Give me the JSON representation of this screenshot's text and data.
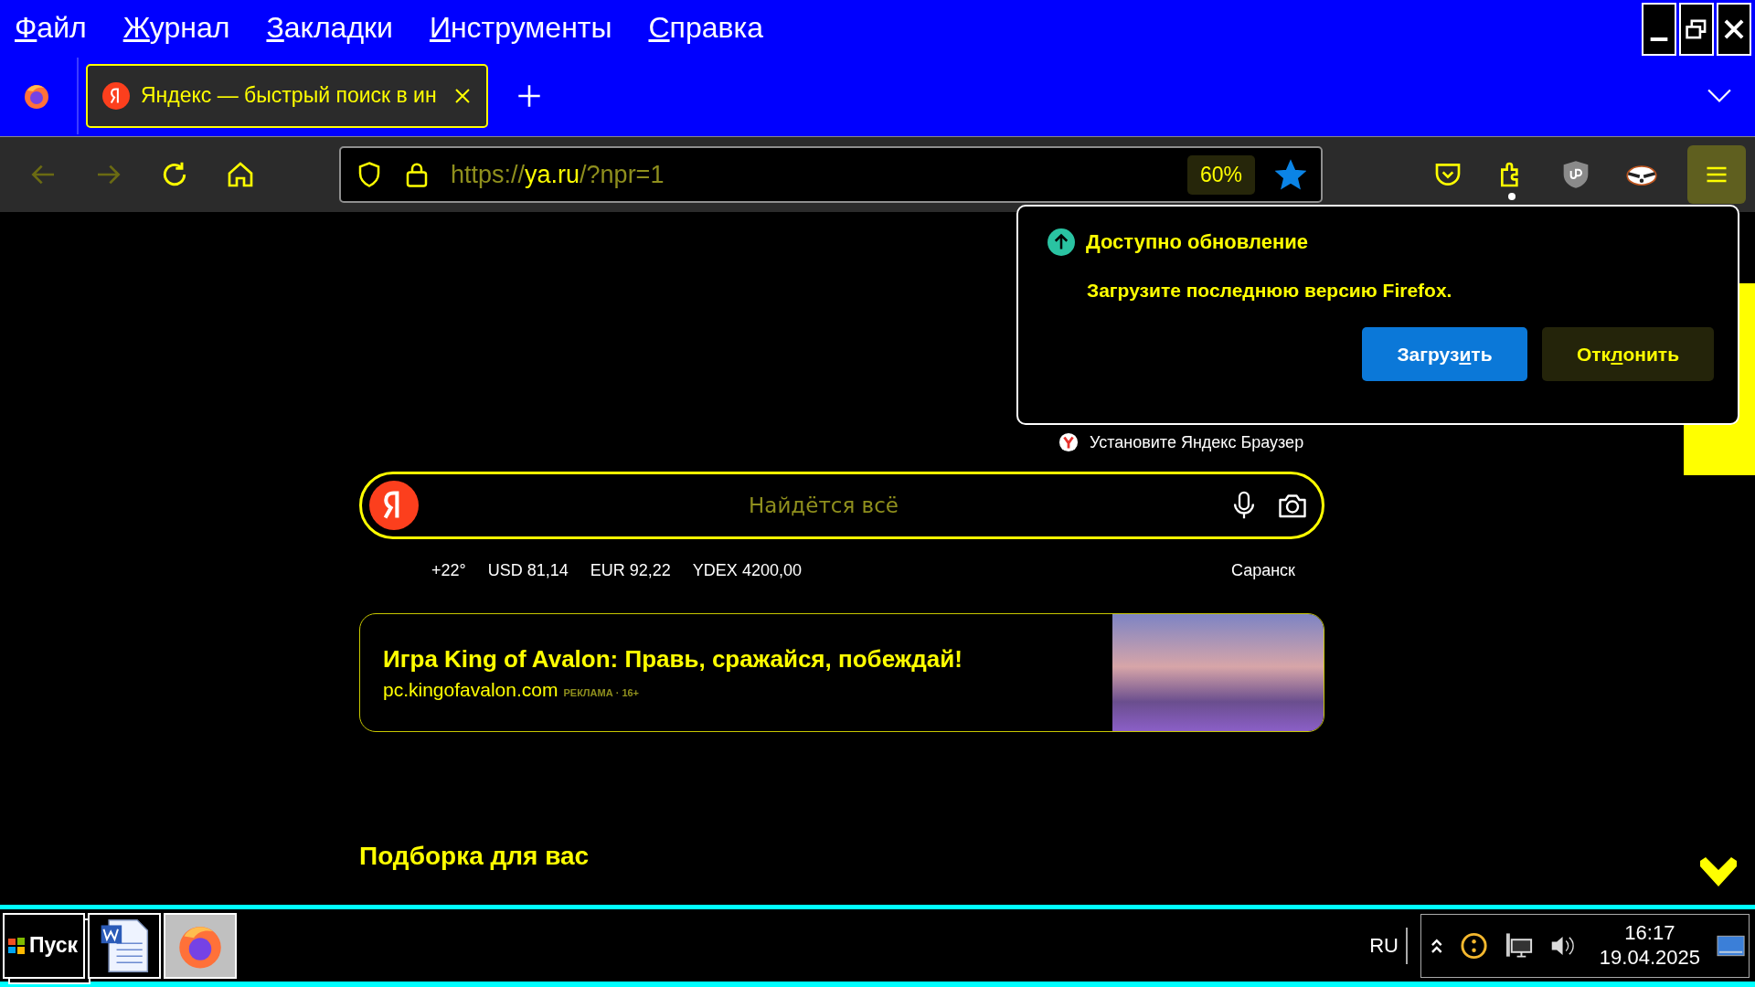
{
  "menu_bar": [
    {
      "accel": "Ф",
      "after": "айл"
    },
    {
      "accel": "Ж",
      "after": "урнал"
    },
    {
      "accel": "З",
      "after": "акладки"
    },
    {
      "accel": "И",
      "after": "нструменты"
    },
    {
      "accel": "С",
      "after": "правка"
    }
  ],
  "tabs": [
    {
      "title": "Яндекс — быстрый поиск в ин",
      "selected": true
    }
  ],
  "toolbar": {
    "back_disabled": true,
    "forward_disabled": true,
    "url": {
      "scheme": "https://",
      "host": "ya.ru",
      "path": "/?npr=1"
    },
    "zoom": "60%",
    "bookmarked": true,
    "extensions_notice": true
  },
  "update_popup": {
    "title": "Доступно обновление",
    "message": "Загрузите последнюю версию Firefox.",
    "buttons": [
      {
        "kind": "primary",
        "before": "Загруз",
        "accel": "и",
        "after": "ть"
      },
      {
        "kind": "secondary",
        "before": "Отк",
        "accel": "л",
        "after": "онить"
      }
    ]
  },
  "install_prompt": "Установите Яндекс Браузер",
  "search": {
    "placeholder": "Найдётся всё"
  },
  "info_line": [
    "+22°",
    "USD 81,14",
    "EUR 92,22",
    "YDEX 4200,00"
  ],
  "city": "Саранск",
  "ad": {
    "title": "Игра King of Avalon: Правь, сражайся, побеждай!",
    "domain": "pc.kingofavalon.com",
    "label": "РЕКЛАМА · 16+"
  },
  "section_title": "Подборка для вас",
  "taskbar": {
    "start": "Пуск",
    "apps": [
      {
        "kind": "word",
        "selected": false
      },
      {
        "kind": "firefox",
        "selected": true
      }
    ],
    "language": "RU",
    "time": "16:17",
    "date": "19.04.2025"
  }
}
